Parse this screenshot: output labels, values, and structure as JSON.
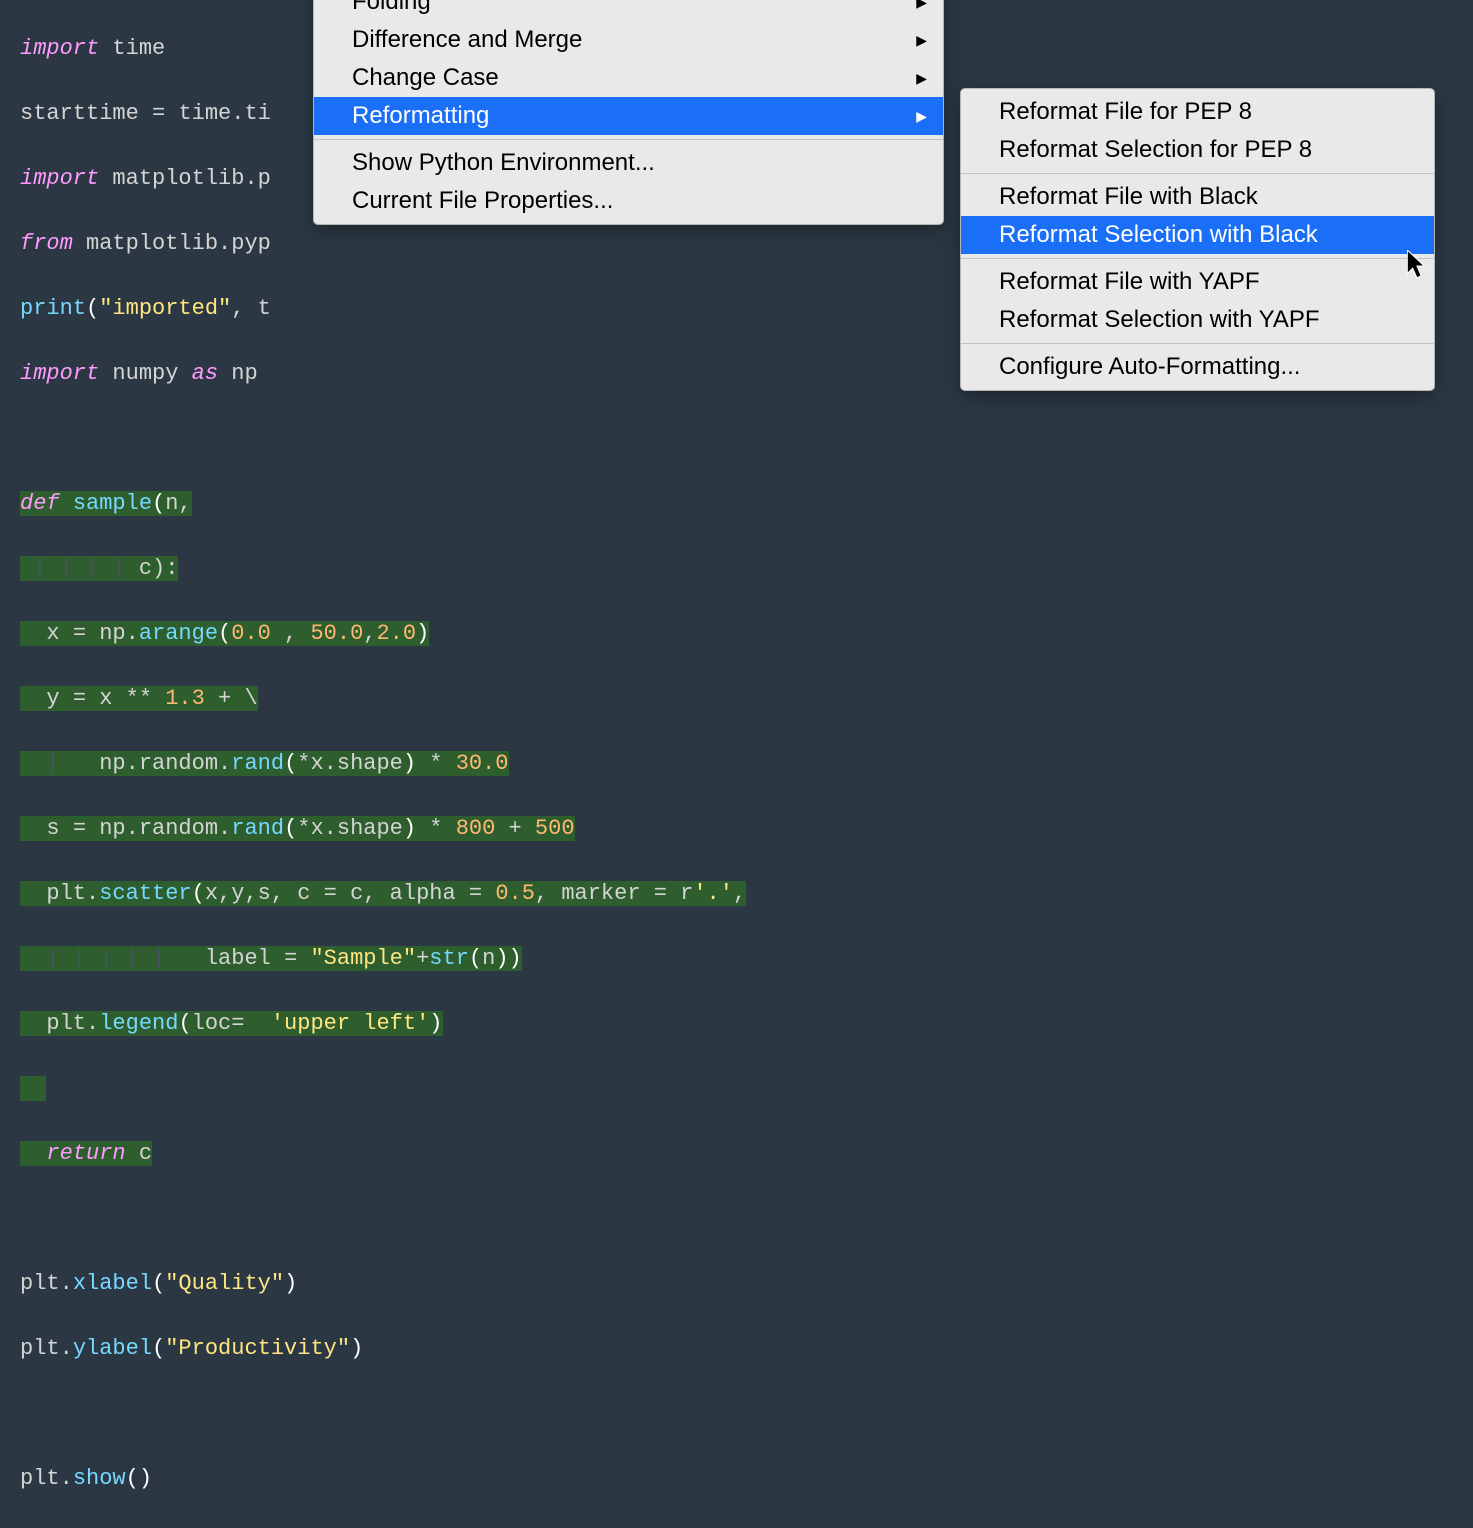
{
  "code": {
    "l1": {
      "kw": "import",
      "sp": " ",
      "id": "time"
    },
    "l2": {
      "t1": "starttime ",
      "op": "=",
      "sp": " ",
      "t2": "time",
      "dot": ".",
      "t3": "ti"
    },
    "l3": {
      "kw": "import",
      "sp": " ",
      "id": "matplotlib",
      "dot": ".",
      "id2": "p"
    },
    "l4": {
      "kw": "from",
      "sp": " ",
      "id": "matplotlib",
      "dot": ".",
      "id2": "pyp"
    },
    "l5": {
      "fn": "print",
      "lp": "(",
      "str": "\"imported\"",
      "comma": ", ",
      "t": "t"
    },
    "l6": {
      "kw": "import",
      "sp": " ",
      "id": "numpy ",
      "kw2": "as",
      "sp2": " ",
      "id2": "np"
    },
    "l7_blank": "",
    "l8": {
      "kw": "def",
      "sp": " ",
      "fn": "sample",
      "lp": "(",
      "arg": "n,"
    },
    "l9": {
      "guides": " | | | |",
      "sp": " c):"
    },
    "l10": {
      "t": "  x ",
      "op": "=",
      "sp": " np",
      "dot": ".",
      "fn": "arange",
      "lp": "(",
      "n1": "0.0",
      "sp2": " , ",
      "n2": "50.0",
      "comma": ",",
      "n3": "2.0",
      ")": ")"
    },
    "l11": {
      "t": "  y ",
      "op": "=",
      "sp": " x ",
      "op2": "**",
      "sp2": " ",
      "n": "1.3",
      "sp3": " ",
      "op3": "+",
      "sp4": " ",
      "bs": "\\"
    },
    "l12": {
      "guide": "  |   ",
      "t": "np",
      "dot": ".",
      "t2": "random",
      "dot2": ".",
      "fn": "rand",
      "lp": "(",
      "op": "*",
      "t3": "x",
      "dot3": ".",
      "t4": "shape",
      ")": ")",
      "sp": " ",
      "op2": "*",
      "sp2": " ",
      "n": "30.0"
    },
    "l13": {
      "t": "  s ",
      "op": "=",
      "sp": " np",
      "dot": ".",
      "t2": "random",
      "dot2": ".",
      "fn": "rand",
      "lp": "(",
      "op2": "*",
      "t3": "x",
      "dot3": ".",
      "t4": "shape",
      ")": ")",
      "sp2": " ",
      "op3": "*",
      "sp3": " ",
      "n": "800",
      "sp4": " ",
      "op4": "+",
      "sp5": " ",
      "n2": "500"
    },
    "l14": {
      "t": "  plt",
      "dot": ".",
      "fn": "scatter",
      "lp": "(",
      "args": "x,y,s, c ",
      "op": "=",
      "sp": " c, alpha ",
      "op2": "=",
      "sp2": " ",
      "n": "0.5",
      "comma": ", marker ",
      "op3": "=",
      "sp3": " r",
      "str": "'.'",
      "end": ","
    },
    "l15": {
      "guides": "  | | | | |   ",
      "t": "label ",
      "op": "=",
      "sp": " ",
      "str": "\"Sample\"",
      "op2": "+",
      "fn": "str",
      "lp": "(",
      "arg": "n",
      "rp": "))"
    },
    "l16": {
      "t": "  plt",
      "dot": ".",
      "fn": "legend",
      "lp": "(",
      "arg": "loc",
      "op": "=",
      "sp": "  ",
      "str": "'upper left'",
      ")": ")"
    },
    "l17_blank": "",
    "l18": {
      "kw": "return",
      "sp": " ",
      "id": "c"
    },
    "l19_blank": "",
    "l20": {
      "t": "plt",
      "dot": ".",
      "fn": "xlabel",
      "lp": "(",
      "str": "\"Quality\"",
      ")": ")"
    },
    "l21": {
      "t": "plt",
      "dot": ".",
      "fn": "ylabel",
      "lp": "(",
      "str": "\"Productivity\"",
      ")": ")"
    },
    "l22_blank": "",
    "l23": {
      "t": "plt",
      "dot": ".",
      "fn": "show",
      "lp": "(",
      ")": ")"
    }
  },
  "menu1": {
    "folding": "Folding",
    "diff": "Difference and Merge",
    "change_case": "Change Case",
    "reformatting": "Reformatting",
    "show_env": "Show Python Environment...",
    "file_props": "Current File Properties..."
  },
  "menu2": {
    "pep8_file": "Reformat File for PEP 8",
    "pep8_sel": "Reformat Selection for PEP 8",
    "black_file": "Reformat File with Black",
    "black_sel": "Reformat Selection with Black",
    "yapf_file": "Reformat File with YAPF",
    "yapf_sel": "Reformat Selection with YAPF",
    "config": "Configure Auto-Formatting..."
  },
  "glyph": {
    "triangle_right": "▶"
  }
}
